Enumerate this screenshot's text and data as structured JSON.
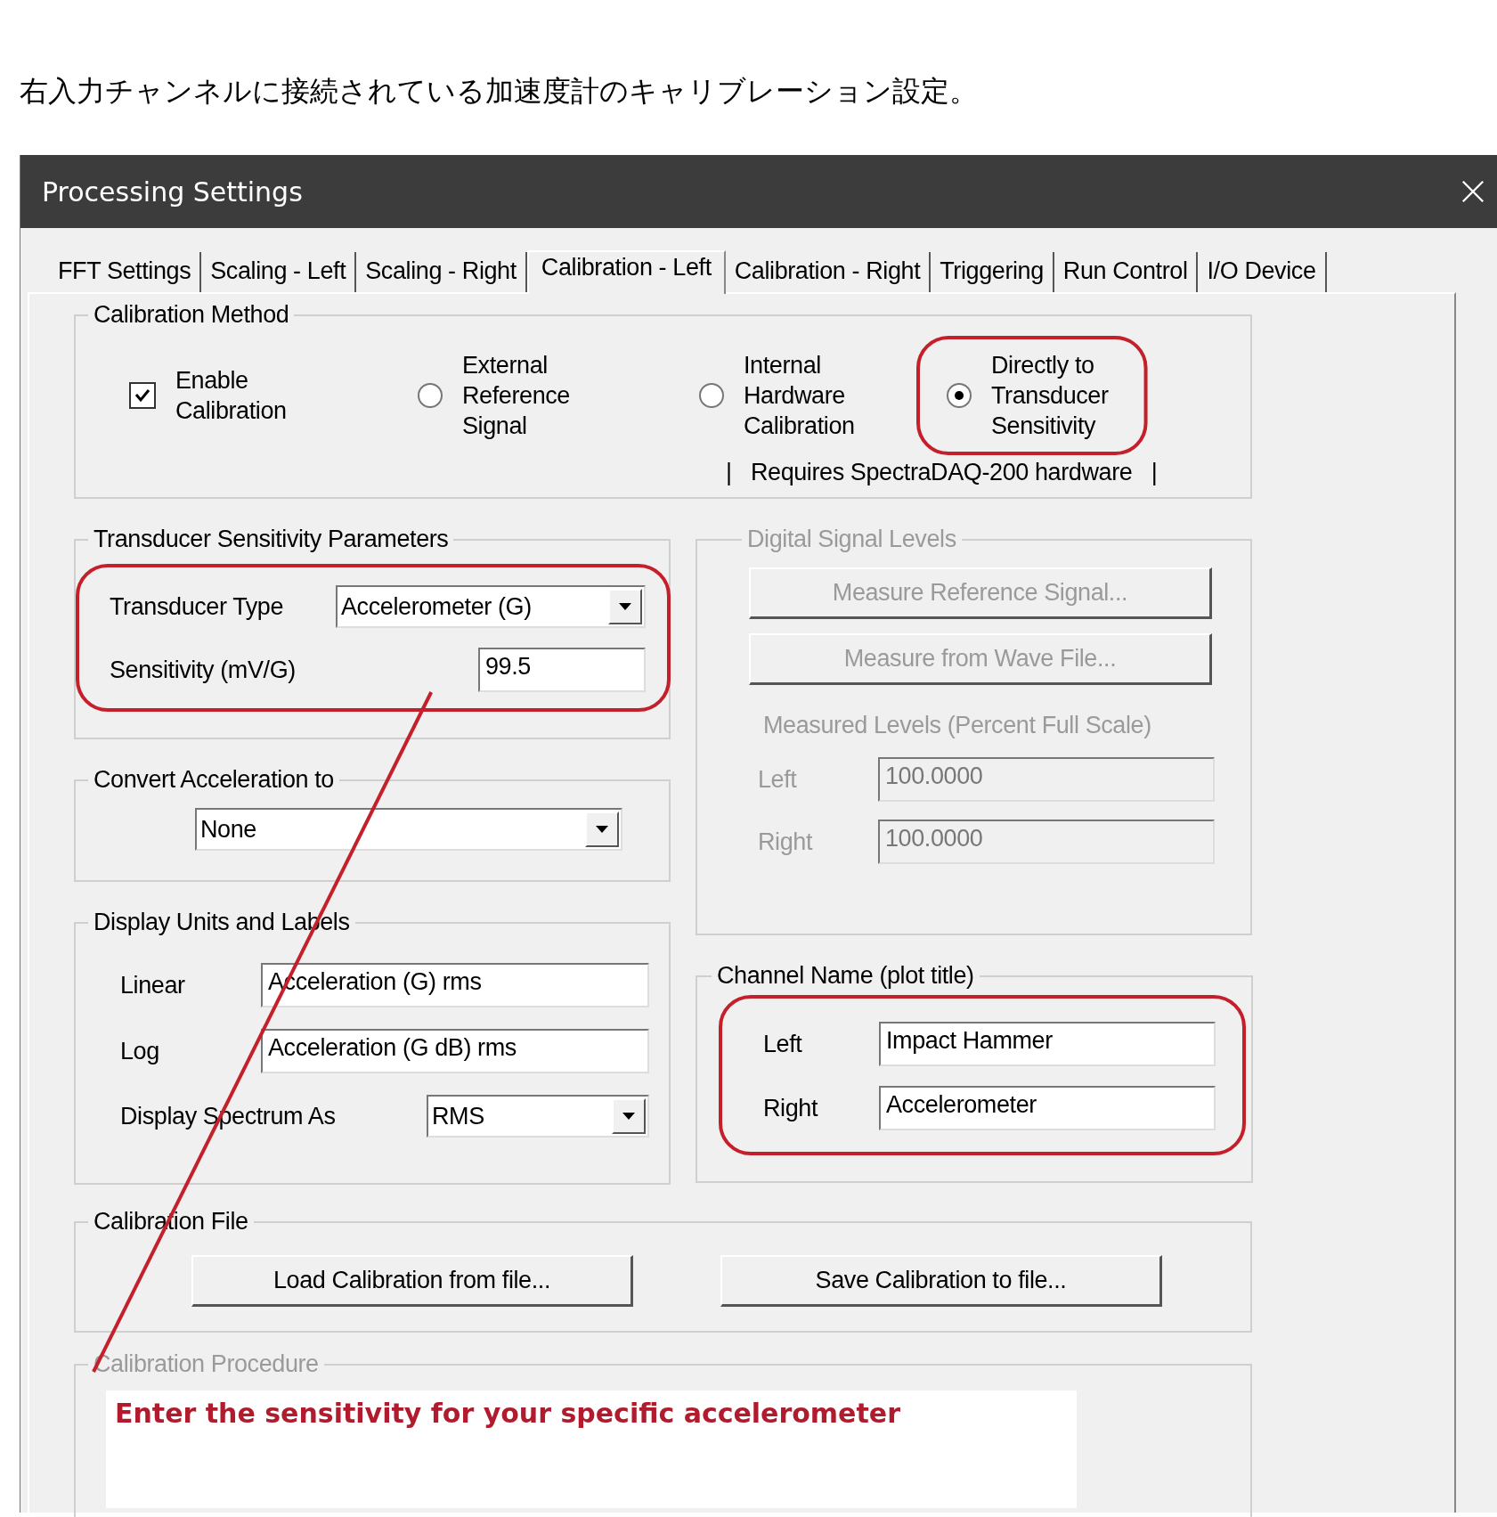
{
  "caption": "右入力チャンネルに接続されている加速度計のキャリブレーション設定。",
  "window": {
    "title": "Processing Settings"
  },
  "tabs": [
    {
      "label": "FFT Settings",
      "selected": false
    },
    {
      "label": "Scaling - Left",
      "selected": false
    },
    {
      "label": "Scaling - Right",
      "selected": false
    },
    {
      "label": "Calibration - Left",
      "selected": true
    },
    {
      "label": "Calibration - Right",
      "selected": false
    },
    {
      "label": "Triggering",
      "selected": false
    },
    {
      "label": "Run Control",
      "selected": false
    },
    {
      "label": "I/O Device",
      "selected": false
    }
  ],
  "calibration_method": {
    "title": "Calibration Method",
    "enable": {
      "label": "Enable\nCalibration",
      "checked": true
    },
    "options": [
      {
        "label": "External\nReference\nSignal",
        "selected": false
      },
      {
        "label": "Internal\nHardware\nCalibration",
        "selected": false
      },
      {
        "label": "Directly to\nTransducer\nSensitivity",
        "selected": true
      }
    ],
    "note": "|   Requires SpectraDAQ-200 hardware   |"
  },
  "transducer": {
    "title": "Transducer Sensitivity Parameters",
    "type_label": "Transducer Type",
    "type_value": "Accelerometer (G)",
    "sensitivity_label": "Sensitivity (mV/G)",
    "sensitivity_value": "99.5"
  },
  "convert": {
    "title": "Convert Acceleration to",
    "value": "None"
  },
  "display_units": {
    "title": "Display Units and Labels",
    "linear_label": "Linear",
    "linear_value": "Acceleration (G) rms",
    "log_label": "Log",
    "log_value": "Acceleration (G dB) rms",
    "spectrum_label": "Display Spectrum As",
    "spectrum_value": "RMS"
  },
  "digital_levels": {
    "title": "Digital Signal Levels",
    "disabled": true,
    "buttons": [
      "Measure Reference Signal...",
      "Measure from Wave File..."
    ],
    "measured_label": "Measured Levels (Percent Full Scale)",
    "left_label": "Left",
    "left_value": "100.0000",
    "right_label": "Right",
    "right_value": "100.0000"
  },
  "channel_name": {
    "title": "Channel Name (plot title)",
    "left_label": "Left",
    "left_value": "Impact Hammer",
    "right_label": "Right",
    "right_value": "Accelerometer"
  },
  "calibration_file": {
    "title": "Calibration File",
    "buttons": [
      "Load Calibration from file...",
      "Save Calibration to file..."
    ]
  },
  "procedure": {
    "title": "Calibration Procedure",
    "disabled": true,
    "text": "Enter the sensitivity for your specific accelerometer"
  }
}
